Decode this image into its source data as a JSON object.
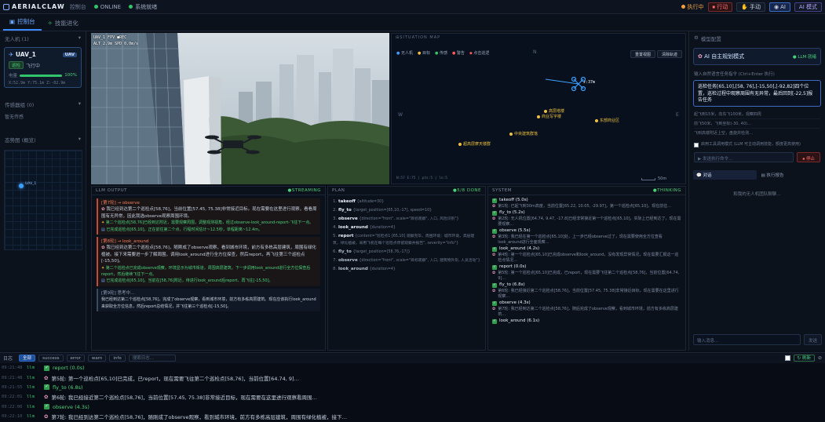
{
  "app": {
    "title": "AERIALCLAW",
    "subtitle": "控制台",
    "online": "ONLINE",
    "system_status": "系统就绪",
    "running": "执行中",
    "stop_label": "⏹ 行动",
    "manual": "手动",
    "ai": "AI",
    "ai_mode": "AI 模式"
  },
  "tabs": [
    {
      "label": "控制台"
    },
    {
      "label": "技能进化"
    }
  ],
  "left": {
    "section_uav": "无人机 (1)",
    "uav": {
      "name": "UAV_1",
      "badge": "UAV",
      "state": "巡检",
      "status": "飞行中",
      "battery_label": "电量",
      "battery": "100%",
      "battery_fill": 1.0,
      "position": "X:52.9m Y:75.1m Z:-02.9m"
    },
    "section_sensor": "传感器组 (0)",
    "sensor_empty": "暂无传感",
    "section_map": "态势图 (概览)",
    "map_marker": "UAV_1"
  },
  "camera": {
    "overlay_1": "UAV_1  FPV  ●REC",
    "overlay_2": "ALT 2.9m  SPD 0.0m/s"
  },
  "map": {
    "title": "SITUATION MAP",
    "legend": [
      "无人机",
      "目标",
      "传感",
      "警告",
      "点击巡逻"
    ],
    "btn_reset": "重置视图",
    "btn_clear": "清除轨迹",
    "compass_n": "N",
    "compass_w": "W",
    "compass_e": "E",
    "uav_label": "z:37m",
    "points": [
      "高层塔楼",
      "商业写字楼",
      "东部商业区",
      "中央建筑群落",
      "超高层摩天楼群"
    ],
    "footer": "N:57 E:75 | pts:5 | ln:5",
    "scale": "50m"
  },
  "llm": {
    "title": "LLM OUTPUT",
    "status": "●STREAMING",
    "blocks": [
      {
        "head": "[第7轮] → observe",
        "text": "我已经到达第二个巡检点[58,76]，当前位置[57.45, 75.38]非常接近目标。现在需要在这里进行观察，看看周围有无异常，因此我选observe观察周围环境。",
        "note1": "第二个巡检点[58,76]已经到达附近，需要观察周围，调整观测视角，经过observe-look_around-report-飞往下一点。",
        "note2": "已完成巡检点[65,10]，正在前往第二个点，行程时间估计~12.5秒，单程距离~12.4m。"
      },
      {
        "head": "[第8轮] → look_around",
        "text": "我已经到达第二个巡检点[58,76]，随刚成了observe观察，看到城市环境，前方有多栋高层建筑，周围有绿化植被。接下来需要进一步了解周围，调用look_around进行全方位探查，然后report，再飞往第三个巡检点[-15,50]。",
        "note1": "第二个巡检点已完成observe观察，环境显示为城市街道，周围高层建筑。下一步调用look_around进行全方位探查后report，然后继续飞往下一点。",
        "note2": "已完成巡检点[65,10]，当前在[58,76]附近，待进行look_around后report、再飞往[-15,50]。"
      },
      {
        "head": "[第9轮] 思考中…",
        "text": "我已经到达第二个巡检点[58,76]，完成了observe观察，看到城市环境，前方有多栋高层建筑。现在应该执行look_around来获取全方位信息，然后report总结情况，并飞往第三个巡检点[-15,50]。"
      }
    ]
  },
  "plan": {
    "title": "PLAN",
    "status": "●5/8 DONE",
    "steps": [
      {
        "n": "1.",
        "name": "takeoff",
        "args": "{altitude=30}",
        "done": true
      },
      {
        "n": "2.",
        "name": "fly_to",
        "args": "{target_position=[65,10,-17], speed=10}",
        "done": true
      },
      {
        "n": "3.",
        "name": "observe",
        "args": "{direction=\"front\", scale=\"目标观察\", 入口, 风险识别\"}",
        "done": true
      },
      {
        "n": "4.",
        "name": "look_around",
        "args": "{duration=4}",
        "done": true
      },
      {
        "n": "5.",
        "name": "report",
        "args": "{content=\"巡检点1 [65,10] 观察完毕，周围环境：城市环境，高层建筑，绿化植被，采用飞机在每个巡检点停留观察并报告\", severity=\"info\"}",
        "done": true
      },
      {
        "n": "6.",
        "name": "fly_to",
        "args": "{target_position=[58,76,-17]}",
        "done": false
      },
      {
        "n": "7.",
        "name": "observe",
        "args": "{direction=\"front\", scale=\"目标观察\", 入口, 建筑物外形, 人员活动\"}",
        "done": false
      },
      {
        "n": "8.",
        "name": "look_around",
        "args": "{duration=4}",
        "done": false
      }
    ]
  },
  "system": {
    "title": "SYSTEM",
    "status": "●THINKING",
    "lines": [
      {
        "kind": "call",
        "text": "takeoff (5.0s)"
      },
      {
        "kind": "think",
        "text": "第1轮: 已起飞到30m高度，当前位置[65.22, 10.05, -29.97]，第一个巡检点[65,10]，现在前往…"
      },
      {
        "kind": "call",
        "text": "fly_to (5.2s)"
      },
      {
        "kind": "think",
        "text": "第2轮: 无人机位置[64.74, 9.47, -17.8]已经非常接近第一个巡检点[65,10]，实际上已经到达了，现在需要观察…"
      },
      {
        "kind": "call",
        "text": "observe (5.5s)"
      },
      {
        "kind": "think",
        "text": "第3轮: 我已经在第一个巡检点[65,10]处，上一步已经observe过了，现在需要使用全方位查看look_around进行全面观察…"
      },
      {
        "kind": "call",
        "text": "look_around (4.2s)"
      },
      {
        "kind": "think",
        "text": "第4轮: 第一个巡检点[65,10]已完成observe和look_around，没有发现异常情况，现在需要汇报这一巡检点情况…"
      },
      {
        "kind": "call",
        "text": "report (0.0s)"
      },
      {
        "kind": "think",
        "text": "第5轮: 第一个巡检点[65,10]已完成，已report，现在需要飞往第二个巡检点[58,76]，当前位置[64.74, 9]…"
      },
      {
        "kind": "call",
        "text": "fly_to (6.8s)"
      },
      {
        "kind": "think",
        "text": "第6轮: 我已经接近第二个巡检点[58,76]，当前位置[57.45, 75.38]非常接近目标，现在需要在这里进行观察…"
      },
      {
        "kind": "call",
        "text": "observe (4.3s)"
      },
      {
        "kind": "think",
        "text": "第7轮: 我已经到达第二个巡检点[58,76]，随后完成了observe观察，看到城市环境，前方有多栋高层建筑…"
      },
      {
        "kind": "call",
        "text": "look_around (6.1s)"
      }
    ]
  },
  "right": {
    "config_title": "模型配置",
    "mode_title": "AI 自主规划模式",
    "mode_badge": "● LLM 就绪",
    "input_label": "输入自然语言任务指令 (Ctrl+Enter 执行)",
    "task_text": "巡检任务[65,10],[58, 76],[-15,50],[-92,82]四个位置，巡检过程中观察周围有无异常，最后回到[-22,5]报告任务",
    "hints": [
      "起飞到15米，向东飞100米，观察四周",
      "前飞50米，飞到坐标(-30, 40)…",
      "飞到高楼附近上空，盘旋并检测…"
    ],
    "checkbox_label": "启用工具调用模式 (LLM 可主动调用技能，额度更高使用)",
    "send_label": "▶ 发送执行命令…",
    "stop_label": "停止",
    "tab_chat": "对话",
    "tab_report": "执行报告",
    "empty": "和我的无人机团队聊聊…",
    "chat_placeholder": "输入消息…",
    "chat_send": "发送"
  },
  "logbar": {
    "label": "日志",
    "filters": [
      "全部",
      "success",
      "error",
      "warn",
      "info"
    ],
    "search_placeholder": "搜索日志…",
    "refresh": "↻ 刷新"
  },
  "logs": [
    {
      "ts": "09:21:48",
      "src": "llm",
      "kind": "call",
      "text": "report (0.0s)"
    },
    {
      "ts": "09:21:48",
      "src": "llm",
      "kind": "think",
      "text": "第5轮: 第一个巡检点[65,10]已完成，已report，现在需要飞往第二个巡检点[58,76]，当前位置[64.74, 9]…"
    },
    {
      "ts": "09:21:55",
      "src": "llm",
      "kind": "call",
      "text": "fly_to (6.8s)"
    },
    {
      "ts": "09:22:01",
      "src": "llm",
      "kind": "think",
      "text": "第6轮: 我已经接近第二个巡检点[58,76]，当前位置[57.45, 75.38]非常接近目标，现在需要在这里进行观察看周围…"
    },
    {
      "ts": "09:22:06",
      "src": "llm",
      "kind": "call",
      "text": "observe (4.3s)"
    },
    {
      "ts": "09:22:10",
      "src": "llm",
      "kind": "think",
      "text": "第7轮: 我已经到达第二个巡检点[58,76]，随刚成了observe观察，看到城市环境，前方有多栋高层建筑，周围有绿化植被，接下…"
    }
  ]
}
